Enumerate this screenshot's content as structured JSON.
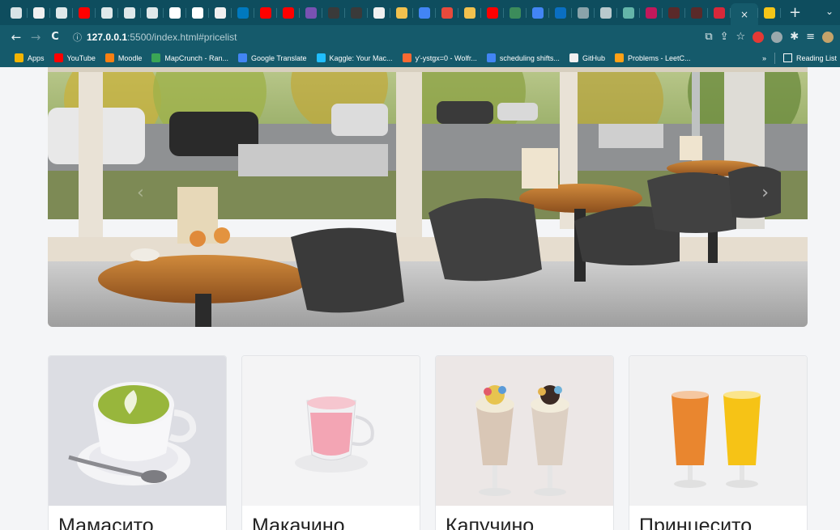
{
  "browser": {
    "tabs": [
      {
        "name": "shield",
        "color": "#d8e3e6"
      },
      {
        "name": "github",
        "color": "#f0f0f0"
      },
      {
        "name": "refresh-site",
        "color": "#dfe8ea"
      },
      {
        "name": "youtube",
        "color": "#ff0000"
      },
      {
        "name": "refresh-site",
        "color": "#dfe8ea"
      },
      {
        "name": "refresh-site",
        "color": "#dfe8ea"
      },
      {
        "name": "refresh-site",
        "color": "#dfe8ea"
      },
      {
        "name": "notion",
        "color": "#ffffff"
      },
      {
        "name": "square",
        "color": "#ffffff"
      },
      {
        "name": "github",
        "color": "#f0f0f0"
      },
      {
        "name": "trello",
        "color": "#0079bf"
      },
      {
        "name": "youtube",
        "color": "#ff0000"
      },
      {
        "name": "youtube",
        "color": "#ff0000"
      },
      {
        "name": "bootstrap",
        "color": "#7952b3"
      },
      {
        "name": "dg",
        "color": "#3a3a3a"
      },
      {
        "name": "dg",
        "color": "#3a3a3a"
      },
      {
        "name": "github",
        "color": "#f0f0f0"
      },
      {
        "name": "chrome-web",
        "color": "#f2c14e"
      },
      {
        "name": "google",
        "color": "#4285f4"
      },
      {
        "name": "ampersand",
        "color": "#e84a3c"
      },
      {
        "name": "chrome-web",
        "color": "#f2c14e"
      },
      {
        "name": "youtube",
        "color": "#ff0000"
      },
      {
        "name": "check",
        "color": "#3c8c5b"
      },
      {
        "name": "google",
        "color": "#4285f4"
      },
      {
        "name": "outlook",
        "color": "#0a6fc2"
      },
      {
        "name": "diamond",
        "color": "#8aa3aa"
      },
      {
        "name": "settings-site",
        "color": "#b9c9cd"
      },
      {
        "name": "z-site",
        "color": "#64b5a9"
      },
      {
        "name": "badge-site",
        "color": "#c2185b"
      },
      {
        "name": "dark-site",
        "color": "#5a2a2a"
      },
      {
        "name": "dark-site",
        "color": "#5a2a2a"
      },
      {
        "name": "red-grid",
        "color": "#d8283a"
      }
    ],
    "active_tab_close": "×",
    "new_tab": "+",
    "tab_menu": "⌄",
    "back": "←",
    "forward": "→",
    "reload": "C",
    "url_host": "127.0.0.1",
    "url_rest": ":5500/index.html#pricelist",
    "url_info_icon": "ⓘ",
    "bookmarks": [
      {
        "label": "Apps",
        "color": "#f4b400"
      },
      {
        "label": "YouTube",
        "color": "#ff0000"
      },
      {
        "label": "Moodle",
        "color": "#f98012"
      },
      {
        "label": "MapCrunch - Ran...",
        "color": "#3aa655"
      },
      {
        "label": "Google Translate",
        "color": "#4285f4"
      },
      {
        "label": "Kaggle: Your Mac...",
        "color": "#20beff"
      },
      {
        "label": "y'-ystgx=0 - Wolfr...",
        "color": "#f96932"
      },
      {
        "label": "scheduling shifts...",
        "color": "#4285f4"
      },
      {
        "label": "GitHub",
        "color": "#f0f0f0"
      },
      {
        "label": "Problems - LeetC...",
        "color": "#ffa116"
      }
    ],
    "bookmarks_overflow": "»",
    "reading_list": "Reading List"
  },
  "hero": {
    "alt_desc": "cafe interior",
    "prev": "‹",
    "next": "›"
  },
  "cards": [
    {
      "title": "Мамасито",
      "image": "matcha-latte"
    },
    {
      "title": "Макачино",
      "image": "pink-latte"
    },
    {
      "title": "Капучино",
      "image": "milkshakes"
    },
    {
      "title": "Принцесито",
      "image": "juices"
    }
  ]
}
